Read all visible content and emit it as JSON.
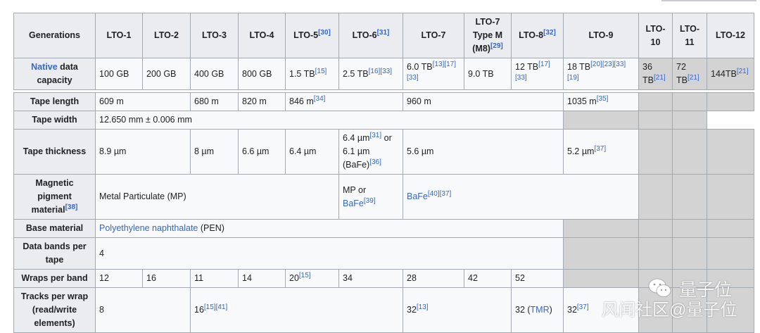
{
  "colors": {
    "header_bg": "#eaecf0",
    "cell_bg": "#f8f9fa",
    "border": "#a2a9b1",
    "link": "#3366cc",
    "unavailable": "#d3d3d3"
  },
  "header": [
    {
      "p": [
        {
          "t": "Generations"
        }
      ]
    },
    {
      "p": [
        {
          "t": "LTO-1"
        }
      ]
    },
    {
      "p": [
        {
          "t": "LTO-2"
        }
      ]
    },
    {
      "p": [
        {
          "t": "LTO-3"
        }
      ]
    },
    {
      "p": [
        {
          "t": "LTO-4"
        }
      ]
    },
    {
      "p": [
        {
          "t": "LTO-5"
        },
        {
          "r": "[30]"
        }
      ]
    },
    {
      "p": [
        {
          "t": "LTO-6"
        },
        {
          "r": "[31]"
        }
      ]
    },
    {
      "p": [
        {
          "t": "LTO-7"
        }
      ]
    },
    {
      "p": [
        {
          "t": "LTO-7 Type M (M8)"
        },
        {
          "r": "[29]"
        }
      ]
    },
    {
      "p": [
        {
          "t": "LTO-8"
        },
        {
          "r": "[32]"
        }
      ]
    },
    {
      "p": [
        {
          "t": "LTO-9"
        }
      ]
    },
    {
      "p": [
        {
          "t": "LTO-10"
        }
      ]
    },
    {
      "p": [
        {
          "t": "LTO-11"
        }
      ]
    },
    {
      "p": [
        {
          "t": "LTO-12"
        }
      ]
    }
  ],
  "rows": [
    {
      "label": [
        {
          "l": "Native"
        },
        {
          "t": " data capacity"
        }
      ],
      "cells": [
        {
          "p": [
            {
              "t": "100 GB"
            }
          ]
        },
        {
          "p": [
            {
              "t": "200 GB"
            }
          ]
        },
        {
          "p": [
            {
              "t": "400 GB"
            }
          ]
        },
        {
          "p": [
            {
              "t": "800 GB"
            }
          ]
        },
        {
          "p": [
            {
              "t": "1.5 TB"
            },
            {
              "r": "[15]"
            }
          ]
        },
        {
          "p": [
            {
              "t": "2.5 TB"
            },
            {
              "r": "[16]"
            },
            {
              "r": "[33]"
            }
          ]
        },
        {
          "p": [
            {
              "t": "6.0 TB"
            },
            {
              "r": "[13]"
            },
            {
              "r": "[17]"
            },
            {
              "r": "[33]"
            }
          ]
        },
        {
          "p": [
            {
              "t": "9.0 TB"
            }
          ]
        },
        {
          "p": [
            {
              "t": "12 TB"
            },
            {
              "r": "[17]"
            },
            {
              "r": "[33]"
            }
          ]
        },
        {
          "p": [
            {
              "t": "18 TB"
            },
            {
              "r": "[20]"
            },
            {
              "r": "[23]"
            },
            {
              "r": "[33]"
            },
            {
              "r": "[19]"
            }
          ]
        },
        {
          "grey": true,
          "p": [
            {
              "t": "36 TB"
            },
            {
              "r": "[21]"
            }
          ]
        },
        {
          "grey": true,
          "p": [
            {
              "t": "72 TB"
            },
            {
              "r": "[21]"
            }
          ]
        },
        {
          "grey": true,
          "p": [
            {
              "t": "144TB"
            },
            {
              "r": "[21]"
            }
          ]
        }
      ]
    },
    {
      "sep": true
    },
    {
      "label": [
        {
          "t": "Tape length"
        }
      ],
      "cells": [
        {
          "span": 2,
          "p": [
            {
              "t": "609 m"
            }
          ]
        },
        {
          "p": [
            {
              "t": "680 m"
            }
          ]
        },
        {
          "p": [
            {
              "t": "820 m"
            }
          ]
        },
        {
          "span": 2,
          "p": [
            {
              "t": "846 m"
            },
            {
              "r": "[34]"
            }
          ]
        },
        {
          "span": 3,
          "p": [
            {
              "t": "960 m"
            }
          ]
        },
        {
          "p": [
            {
              "t": "1035 m"
            },
            {
              "r": "[35]"
            }
          ]
        },
        {
          "grey": true,
          "p": []
        },
        {
          "grey": true,
          "p": []
        },
        {
          "grey": true,
          "p": []
        }
      ]
    },
    {
      "label": [
        {
          "t": "Tape width"
        }
      ],
      "cells": [
        {
          "span": 9,
          "p": [
            {
              "t": "12.650 mm ± 0.006 mm"
            }
          ]
        },
        {
          "grey": true,
          "p": []
        },
        {
          "grey": true,
          "p": []
        },
        {
          "grey": true,
          "p": []
        }
      ]
    },
    {
      "label": [
        {
          "t": "Tape thickness"
        }
      ],
      "cells": [
        {
          "span": 2,
          "p": [
            {
              "t": "8.9 µm"
            }
          ]
        },
        {
          "p": [
            {
              "t": "8 µm"
            }
          ]
        },
        {
          "p": [
            {
              "t": "6.6 µm"
            }
          ]
        },
        {
          "p": [
            {
              "t": "6.4 µm"
            }
          ]
        },
        {
          "p": [
            {
              "t": "6.4 µm"
            },
            {
              "r": "[31]"
            },
            {
              "t": " or 6.1 µm (BaFe)"
            },
            {
              "r": "[36]"
            }
          ]
        },
        {
          "span": 3,
          "p": [
            {
              "t": "5.6 µm"
            }
          ]
        },
        {
          "p": [
            {
              "t": "5.2 µm"
            },
            {
              "r": "[37]"
            }
          ]
        },
        {
          "grey": true,
          "p": []
        },
        {
          "grey": true,
          "p": []
        },
        {
          "grey": true,
          "p": []
        }
      ]
    },
    {
      "label": [
        {
          "t": "Magnetic pigment material"
        },
        {
          "r": "[38]"
        }
      ],
      "cells": [
        {
          "span": 5,
          "p": [
            {
              "t": "Metal Particulate (MP)"
            }
          ]
        },
        {
          "p": [
            {
              "t": "MP or "
            },
            {
              "l": "BaFe"
            },
            {
              "r": "[39]"
            }
          ]
        },
        {
          "span": 4,
          "p": [
            {
              "l": "BaFe"
            },
            {
              "r": "[40]"
            },
            {
              "r": "[37]"
            }
          ]
        },
        {
          "grey": true,
          "p": []
        },
        {
          "grey": true,
          "p": []
        },
        {
          "grey": true,
          "p": []
        }
      ]
    },
    {
      "label": [
        {
          "t": "Base material"
        }
      ],
      "cells": [
        {
          "span": 9,
          "p": [
            {
              "l": "Polyethylene naphthalate"
            },
            {
              "t": " (PEN)"
            }
          ]
        },
        {
          "grey": true,
          "p": []
        },
        {
          "grey": true,
          "p": []
        },
        {
          "grey": true,
          "p": []
        },
        {
          "grey": true,
          "p": []
        }
      ]
    },
    {
      "label": [
        {
          "t": "Data bands per tape"
        }
      ],
      "cells": [
        {
          "span": 9,
          "p": [
            {
              "t": "4"
            }
          ]
        },
        {
          "grey": true,
          "p": []
        },
        {
          "grey": true,
          "p": []
        },
        {
          "grey": true,
          "p": []
        },
        {
          "grey": true,
          "p": []
        }
      ]
    },
    {
      "label": [
        {
          "t": "Wraps per band"
        }
      ],
      "cells": [
        {
          "p": [
            {
              "t": "12"
            }
          ]
        },
        {
          "p": [
            {
              "t": "16"
            }
          ]
        },
        {
          "p": [
            {
              "t": "11"
            }
          ]
        },
        {
          "p": [
            {
              "t": "14"
            }
          ]
        },
        {
          "p": [
            {
              "t": "20"
            },
            {
              "r": "[15]"
            }
          ]
        },
        {
          "p": [
            {
              "t": "34"
            }
          ]
        },
        {
          "p": [
            {
              "t": "28"
            }
          ]
        },
        {
          "p": [
            {
              "t": "42"
            }
          ]
        },
        {
          "p": [
            {
              "t": "52"
            }
          ]
        },
        {
          "grey": true,
          "p": []
        },
        {
          "grey": true,
          "p": []
        },
        {
          "grey": true,
          "p": []
        },
        {
          "grey": true,
          "p": []
        }
      ]
    },
    {
      "label": [
        {
          "t": "Tracks per wrap (read/write elements)"
        }
      ],
      "cells": [
        {
          "span": 2,
          "p": [
            {
              "t": "8"
            }
          ]
        },
        {
          "span": 4,
          "p": [
            {
              "t": "16"
            },
            {
              "r": "[15]"
            },
            {
              "r": "[41]"
            }
          ]
        },
        {
          "span": 2,
          "p": [
            {
              "t": "32"
            },
            {
              "r": "[13]"
            }
          ]
        },
        {
          "p": [
            {
              "t": "32 ("
            },
            {
              "l": "TMR"
            },
            {
              "t": ")"
            }
          ]
        },
        {
          "p": [
            {
              "t": "32"
            },
            {
              "r": "[37]"
            }
          ]
        },
        {
          "grey": true,
          "p": []
        },
        {
          "grey": true,
          "p": []
        },
        {
          "grey": true,
          "p": []
        }
      ]
    }
  ],
  "watermark": {
    "line1": "量子位",
    "line2": "风闻社区@量子位",
    "icon": "wechat-icon"
  }
}
